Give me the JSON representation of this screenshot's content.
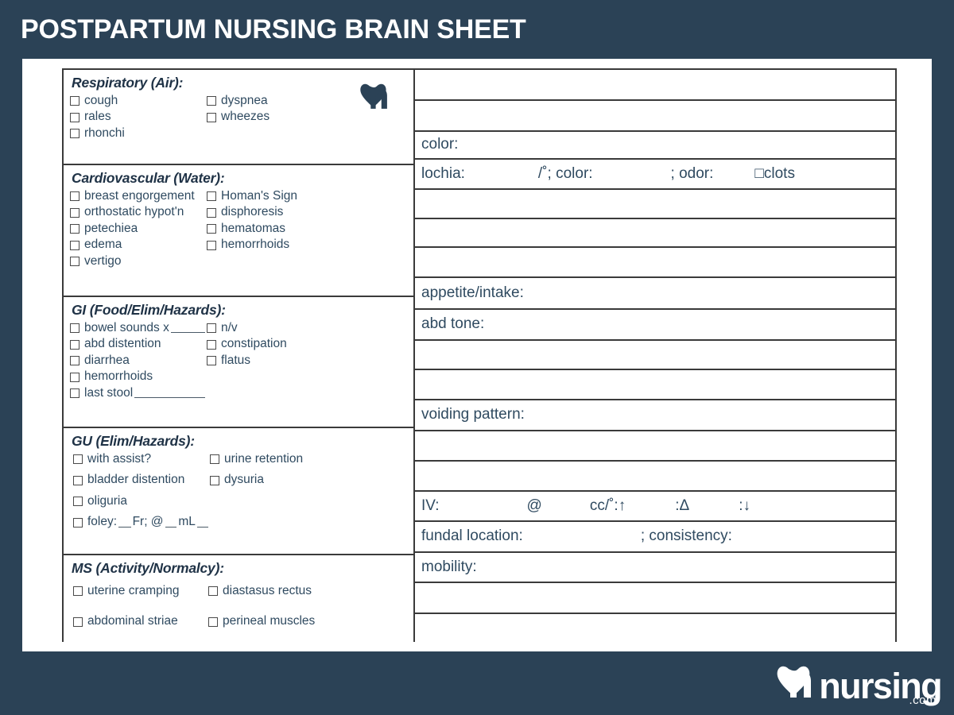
{
  "header": {
    "title": "POSTPARTUM NURSING BRAIN SHEET",
    "bg_color": "#2b4256",
    "text_color": "#ffffff"
  },
  "logo": {
    "mark_name": "nursing-heart-n-logo",
    "word": "nursing",
    "suffix": ".com",
    "color": "#ffffff",
    "mark_color": "#2b4256"
  },
  "form": {
    "left_sections": [
      {
        "id": "respiratory",
        "heading": "Respiratory (Air):",
        "rows": [
          [
            {
              "label": "cough",
              "type": "checkbox"
            },
            {
              "label": "dyspnea",
              "type": "checkbox"
            }
          ],
          [
            {
              "label": "rales",
              "type": "checkbox"
            },
            {
              "label": "wheezes",
              "type": "checkbox"
            }
          ],
          [
            {
              "label": "rhonchi",
              "type": "checkbox"
            }
          ]
        ]
      },
      {
        "id": "cardiovascular",
        "heading": "Cardiovascular (Water):",
        "rows": [
          [
            {
              "label": "breast engorgement",
              "type": "checkbox"
            },
            {
              "label": "Homan's Sign",
              "type": "checkbox"
            }
          ],
          [
            {
              "label": "orthostatic hypot'n",
              "type": "checkbox"
            },
            {
              "label": "disphoresis",
              "type": "checkbox"
            }
          ],
          [
            {
              "label": "petechiea",
              "type": "checkbox"
            },
            {
              "label": "hematomas",
              "type": "checkbox"
            }
          ],
          [
            {
              "label": "edema",
              "type": "checkbox"
            },
            {
              "label": "hemorrhoids",
              "type": "checkbox"
            }
          ],
          [
            {
              "label": "vertigo",
              "type": "checkbox"
            }
          ]
        ]
      },
      {
        "id": "gi",
        "heading": "GI (Food/Elim/Hazards):",
        "rows": [
          [
            {
              "label": "bowel sounds x",
              "type": "checkbox",
              "blank": 58
            },
            {
              "label": "n/v",
              "type": "checkbox"
            }
          ],
          [
            {
              "label": "abd distention",
              "type": "checkbox"
            },
            {
              "label": "constipation",
              "type": "checkbox"
            }
          ],
          [
            {
              "label": "diarrhea",
              "type": "checkbox"
            },
            {
              "label": "flatus",
              "type": "checkbox"
            }
          ],
          [
            {
              "label": "hemorrhoids",
              "type": "checkbox"
            }
          ],
          [
            {
              "label": "last stool",
              "type": "checkbox",
              "blank": 112
            }
          ]
        ]
      },
      {
        "id": "gu",
        "heading": "GU (Elim/Hazards):",
        "rows": [
          [
            {
              "label": "with assist?",
              "type": "checkbox"
            },
            {
              "label": "urine retention",
              "type": "checkbox"
            }
          ],
          [
            {
              "label": "bladder distention",
              "type": "checkbox"
            },
            {
              "label": "dysuria",
              "type": "checkbox"
            }
          ],
          [
            {
              "label": "oliguria",
              "type": "checkbox"
            }
          ],
          [
            {
              "label": "foley:",
              "type": "checkbox",
              "blank": 44,
              "label2": "Fr; @",
              "blank2": 42,
              "label3": "mL",
              "blank3": 40
            }
          ]
        ]
      },
      {
        "id": "ms",
        "heading": "MS (Activity/Normalcy):",
        "rows": [
          [
            {
              "label": "uterine  cramping",
              "type": "checkbox"
            },
            {
              "label": "diastasus rectus",
              "type": "checkbox"
            }
          ],
          [
            {
              "label": "abdominal striae",
              "type": "checkbox"
            },
            {
              "label": "perineal muscles",
              "type": "checkbox"
            }
          ]
        ]
      }
    ],
    "right_rows": [
      {
        "id": "r-blank-1",
        "text": ""
      },
      {
        "id": "r-blank-2",
        "text": ""
      },
      {
        "id": "r-color",
        "text": "color:"
      },
      {
        "id": "r-lochia",
        "segments": [
          {
            "text": "lochia:",
            "gap": 92
          },
          {
            "text": "/˚; color:",
            "gap": 98
          },
          {
            "text": "; odor:",
            "gap": 52
          },
          {
            "text": "□clots",
            "gap": 0
          }
        ]
      },
      {
        "id": "r-blank-3",
        "text": ""
      },
      {
        "id": "r-blank-4",
        "text": ""
      },
      {
        "id": "r-blank-5",
        "text": ""
      },
      {
        "id": "r-appetite",
        "text": "appetite/intake:"
      },
      {
        "id": "r-abdtone",
        "text": "abd tone:"
      },
      {
        "id": "r-blank-6",
        "text": ""
      },
      {
        "id": "r-blank-7",
        "text": ""
      },
      {
        "id": "r-voiding",
        "text": "voiding pattern:"
      },
      {
        "id": "r-blank-8",
        "text": ""
      },
      {
        "id": "r-blank-9",
        "text": ""
      },
      {
        "id": "r-iv",
        "segments": [
          {
            "text": "IV:",
            "gap": 110
          },
          {
            "text": "@",
            "gap": 60
          },
          {
            "text": "cc/˚:↑",
            "gap": 62
          },
          {
            "text": ":Δ",
            "gap": 62
          },
          {
            "text": ":↓",
            "gap": 0
          }
        ]
      },
      {
        "id": "r-fundal",
        "segments": [
          {
            "text": "fundal location:",
            "gap": 148
          },
          {
            "text": "; consistency:",
            "gap": 0
          }
        ]
      },
      {
        "id": "r-mobility",
        "text": "mobility:"
      },
      {
        "id": "r-blank-10",
        "text": ""
      },
      {
        "id": "r-blank-11",
        "text": ""
      }
    ]
  }
}
